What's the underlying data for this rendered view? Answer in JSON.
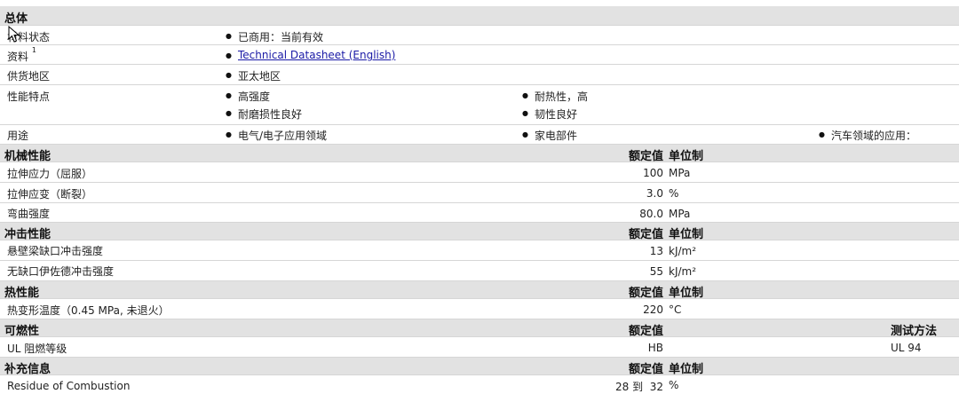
{
  "general": {
    "header": "总体",
    "material_status_label": "材料状态",
    "material_status_value": "已商用：当前有效",
    "documents_label": "资料",
    "documents_sup": "1",
    "documents_link": "Technical Datasheet (English)",
    "availability_label": "供货地区",
    "availability_value": "亚太地区",
    "features_label": "性能特点",
    "features": [
      "高强度",
      "耐热性，高",
      "耐磨损性良好",
      "韧性良好"
    ],
    "uses_label": "用途",
    "uses": [
      "电气/电子应用领域",
      "家电部件",
      "汽车领域的应用："
    ]
  },
  "mechanical": {
    "header": "机械性能",
    "nominal_label": "额定值",
    "unit_label": "单位制",
    "rows": [
      {
        "name": "拉伸应力（屈服）",
        "value": "100",
        "unit": "MPa"
      },
      {
        "name": "拉伸应变（断裂）",
        "value": "3.0",
        "unit": "%"
      },
      {
        "name": "弯曲强度",
        "value": "80.0",
        "unit": "MPa"
      }
    ]
  },
  "impact": {
    "header": "冲击性能",
    "nominal_label": "额定值",
    "unit_label": "单位制",
    "rows": [
      {
        "name": "悬壁梁缺口冲击强度",
        "value": "13",
        "unit": "kJ/m²"
      },
      {
        "name": "无缺口伊佐德冲击强度",
        "value": "55",
        "unit": "kJ/m²"
      }
    ]
  },
  "thermal": {
    "header": "热性能",
    "nominal_label": "额定值",
    "unit_label": "单位制",
    "rows": [
      {
        "name": "热变形温度（0.45 MPa, 未退火）",
        "value": "220",
        "unit": "°C"
      }
    ]
  },
  "flammability": {
    "header": "可燃性",
    "nominal_label": "额定值",
    "method_label": "测试方法",
    "rows": [
      {
        "name": "UL 阻燃等级",
        "value": "HB",
        "method": "UL 94"
      }
    ]
  },
  "supplemental": {
    "header": "补充信息",
    "nominal_label": "额定值",
    "unit_label": "单位制",
    "rows": [
      {
        "name": "Residue of Combustion",
        "value": "28 到  32",
        "unit": "%"
      }
    ]
  }
}
